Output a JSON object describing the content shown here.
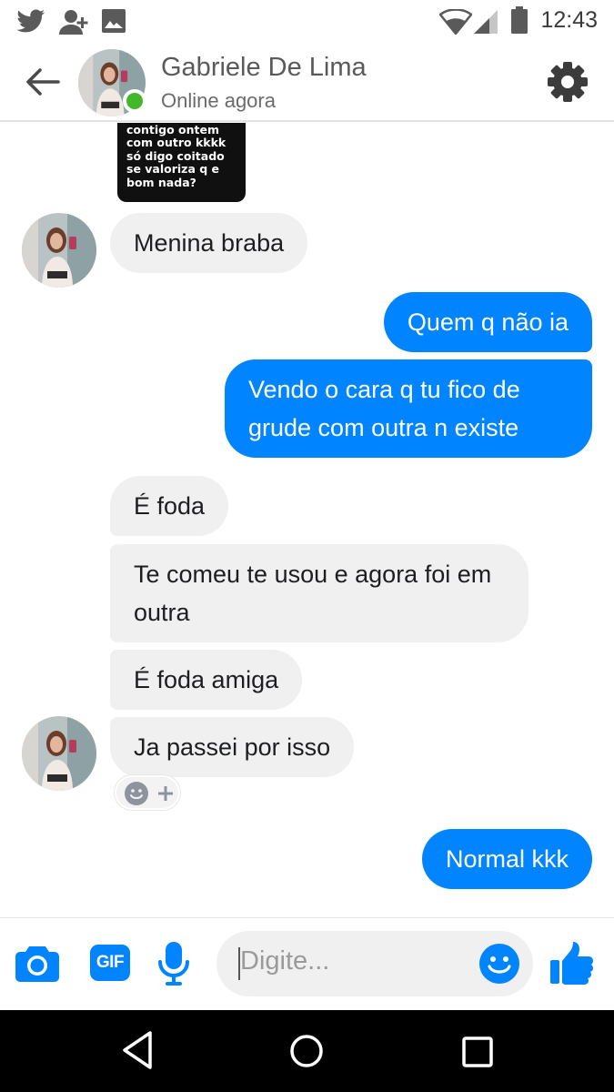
{
  "status_bar": {
    "time": "12:43",
    "icons": [
      "twitter-icon",
      "add-contact-icon",
      "image-icon",
      "wifi-icon",
      "signal-icon",
      "battery-icon"
    ]
  },
  "header": {
    "name": "Gabriele De Lima",
    "status": "Online agora",
    "icons": [
      "back-arrow-icon",
      "gear-icon"
    ]
  },
  "sticker": {
    "text": "agarrada\ncontigo ontem\ncom outro kkkk\nsó digo coitado\nse valoriza q e\nbom nada?"
  },
  "messages": [
    {
      "from": "them",
      "text": "Menina braba"
    },
    {
      "from": "me",
      "text": "Quem q não ia"
    },
    {
      "from": "me",
      "text": "Vendo o cara q tu fico de grude com outra n existe"
    },
    {
      "from": "them",
      "text": "É foda"
    },
    {
      "from": "them",
      "text": "Te comeu te usou e agora foi em outra"
    },
    {
      "from": "them",
      "text": "É foda amiga"
    },
    {
      "from": "them",
      "text": "Ja passei por isso"
    },
    {
      "from": "me",
      "text": "Normal kkk"
    }
  ],
  "composer": {
    "placeholder": "Digite...",
    "gif_label": "GIF",
    "icons": [
      "camera-icon",
      "gif-icon",
      "microphone-icon",
      "emoji-icon",
      "thumbs-up-icon"
    ]
  },
  "colors": {
    "outgoing_bubble": "#0084ff",
    "incoming_bubble": "#f1f0f0",
    "online_dot": "#42b72a",
    "accent": "#0084ff"
  }
}
